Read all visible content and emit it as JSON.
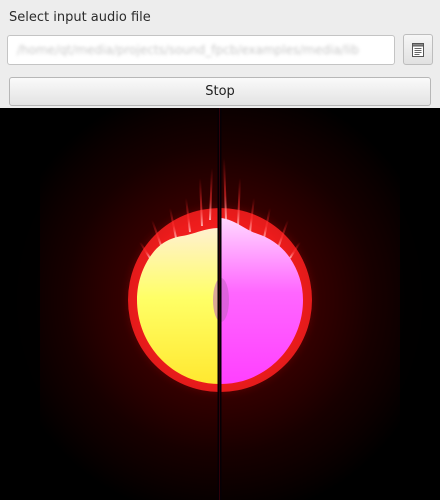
{
  "header": {
    "label": "Select input audio file"
  },
  "file_input": {
    "value": "/home/qt/media/projects/sound_fpcb/examples/media/lib"
  },
  "browse_button": {
    "icon": "file-browse-icon"
  },
  "stop_button": {
    "label": "Stop"
  },
  "visualizer": {
    "left_color": "#ffff44",
    "right_color": "#ff44ff",
    "glow_color": "#ff2222"
  }
}
